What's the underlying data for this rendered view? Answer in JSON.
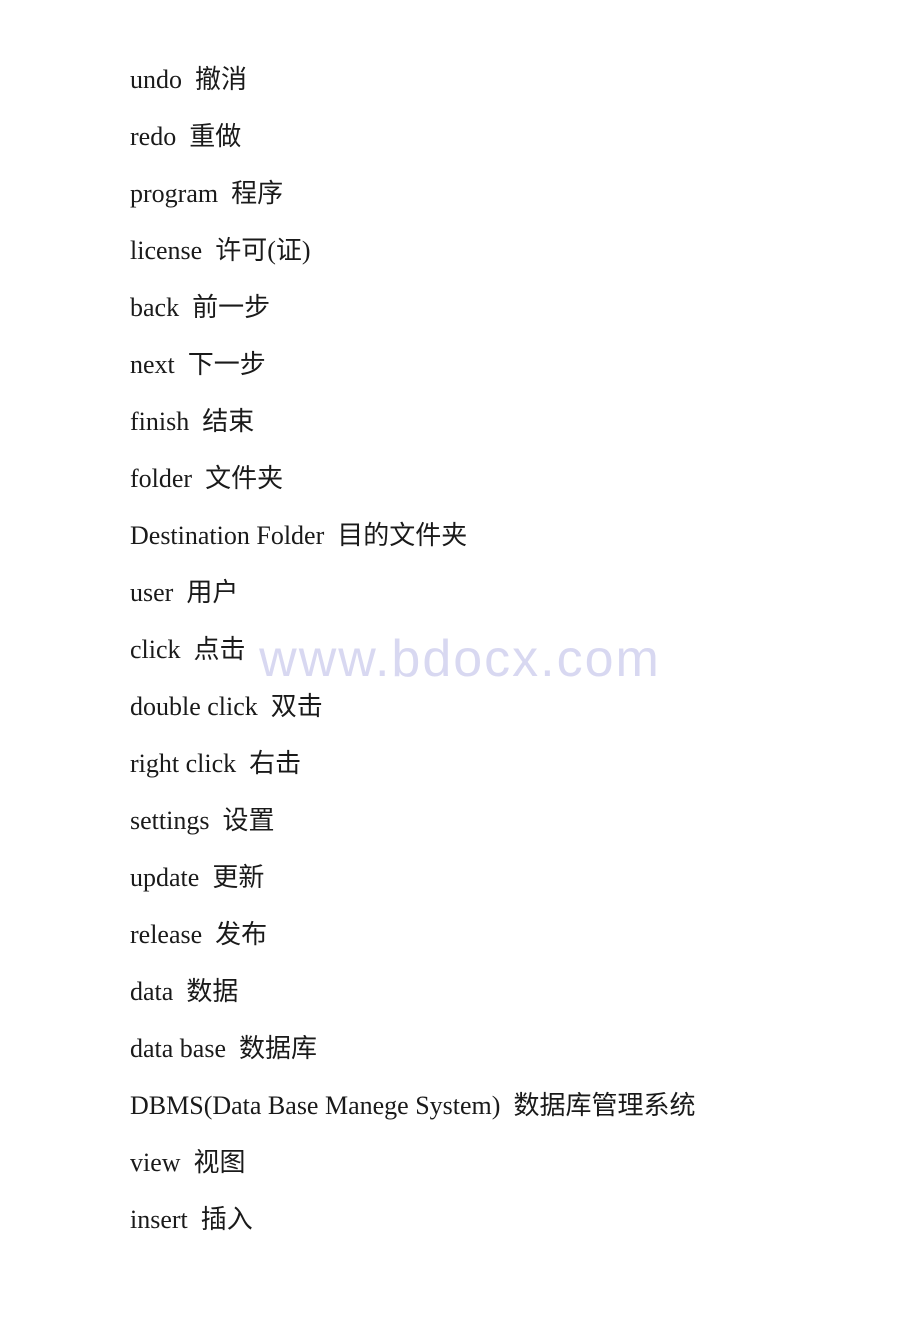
{
  "watermark": "www.bdocx.com",
  "vocab": [
    {
      "english": "undo",
      "chinese": "撤消"
    },
    {
      "english": "redo",
      "chinese": "重做"
    },
    {
      "english": "program",
      "chinese": "程序"
    },
    {
      "english": "license",
      "chinese": "许可(证)"
    },
    {
      "english": "back",
      "chinese": "前一步"
    },
    {
      "english": "next",
      "chinese": "下一步"
    },
    {
      "english": "finish",
      "chinese": "结束"
    },
    {
      "english": "folder",
      "chinese": "文件夹"
    },
    {
      "english": "Destination Folder",
      "chinese": "目的文件夹"
    },
    {
      "english": "user",
      "chinese": "用户"
    },
    {
      "english": "click",
      "chinese": "点击"
    },
    {
      "english": "double click",
      "chinese": "双击"
    },
    {
      "english": "right click",
      "chinese": "右击"
    },
    {
      "english": "settings",
      "chinese": "设置"
    },
    {
      "english": "update",
      "chinese": "更新"
    },
    {
      "english": "release",
      "chinese": "发布"
    },
    {
      "english": "data",
      "chinese": "数据"
    },
    {
      "english": "data base",
      "chinese": "数据库"
    },
    {
      "english": "DBMS(Data Base Manege System)",
      "chinese": "数据库管理系统"
    },
    {
      "english": "view",
      "chinese": "视图"
    },
    {
      "english": "insert",
      "chinese": "插入"
    }
  ]
}
